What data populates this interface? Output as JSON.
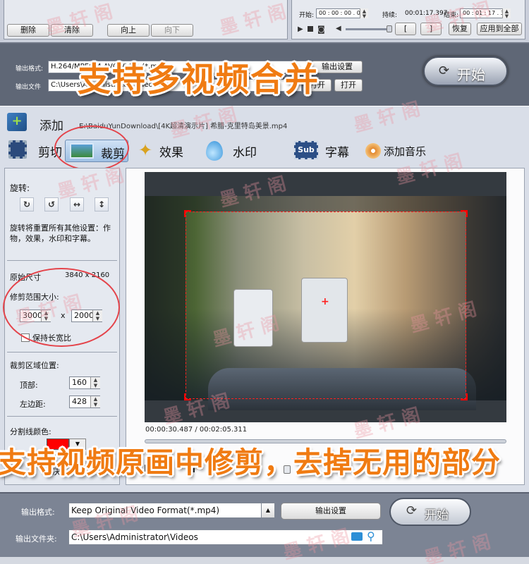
{
  "top_panel": {
    "delete_btn": "删除",
    "clear_btn": "清除",
    "up_btn": "向上",
    "down_btn": "向下",
    "start_label": "开始:",
    "start_time": "00 : 00 : 00 . 000",
    "duration_label": "持续:",
    "duration_value": "00:01:17.397",
    "end_label": "结束:",
    "end_time": "00 : 01 : 17 . 397",
    "bracket_open": "[",
    "bracket_close": "]",
    "restore_btn": "恢复",
    "apply_all_btn": "应用到全部",
    "format_label": "输出格式:",
    "format_value": "H.264/MPEG-4 AVC Video (*.mp4)",
    "folder_label": "输出文件",
    "folder_value": "C:\\Users\\Administrator\\Videos",
    "settings_btn": "输出设置",
    "browse_btn": "打开",
    "start_btn": "开始"
  },
  "banner_top": "支持多视频合并",
  "editor": {
    "add_label": "添加",
    "file_path": "E:\\BaiduYunDownload\\[4K超清演示片] 希腊-克里特岛美景.mp4",
    "tabs": {
      "trim": "剪切",
      "crop": "裁剪",
      "effect": "效果",
      "watermark": "水印",
      "subtitle": "字幕",
      "music": "添加音乐"
    }
  },
  "crop_panel": {
    "rotate_label": "旋转:",
    "rotate_note": "旋转将重置所有其他设置：作物，效果，水印和字幕。",
    "orig_size_label": "原始尺寸",
    "orig_size_value": "3840 x 2160",
    "crop_size_label": "修剪范围大小:",
    "width": "3000",
    "x_sep": "x",
    "height": "2000",
    "keep_ratio": "保持长宽比",
    "pos_label": "裁剪区域位置:",
    "top_label": "顶部:",
    "top_value": "160",
    "left_label": "左边距:",
    "left_value": "428",
    "line_color_label": "分割线颜色:",
    "line_color": "#ff0000",
    "partial_text": "决"
  },
  "preview": {
    "time": "00:00:30.487 / 00:02:05.311"
  },
  "banner_bottom": "支持视频原画中修剪，去掉无用的部分",
  "bottom": {
    "format_label": "输出格式:",
    "format_value": "Keep Original Video Format(*.mp4)",
    "settings_btn": "输出设置",
    "folder_label": "输出文件夹:",
    "folder_value": "C:\\Users\\Administrator\\Videos",
    "start_btn": "开始"
  },
  "watermark": "墨 轩 阁",
  "colors": {
    "accent_orange": "#f07b12",
    "crop_red": "#ff0000",
    "panel_bg": "#d9dee8"
  }
}
